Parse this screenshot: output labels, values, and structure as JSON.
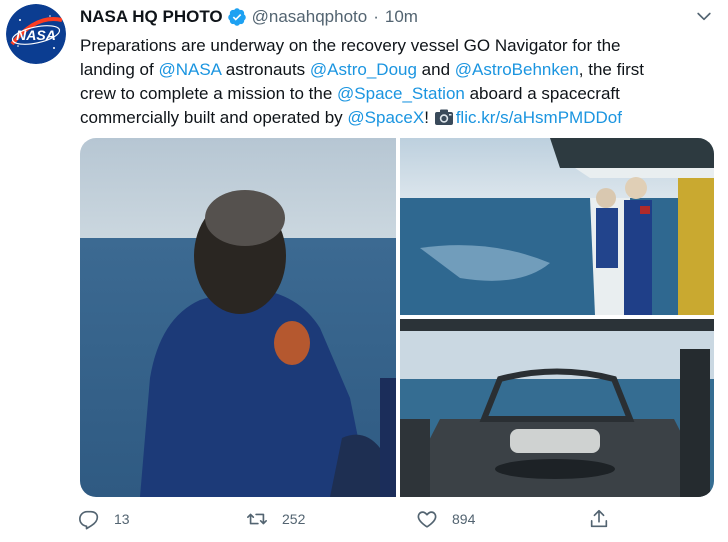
{
  "tweet": {
    "display_name": "NASA HQ PHOTO",
    "handle": "@nasahqphoto",
    "separator": "·",
    "time": "10m",
    "text_runs": [
      "Preparations are underway on the recovery vessel GO Navigator for the",
      "landing of ",
      "@NASA",
      " astronauts ",
      "@Astro_Doug",
      " and ",
      "@AstroBehnken",
      ", the first",
      "crew to complete a mission to the ",
      "@Space_Station",
      " aboard a spacecraft",
      "commercially built and operated by ",
      "@SpaceX",
      "! ",
      "flic.kr/s/aHsmPMDDof"
    ]
  },
  "avatar": {
    "logo_text": "NASA"
  },
  "icons": {
    "verified": "verified-badge-icon",
    "more": "chevron-down-icon",
    "camera": "camera-icon",
    "reply": "reply-icon",
    "retweet": "retweet-icon",
    "like": "heart-icon",
    "share": "share-icon"
  },
  "media": [
    {
      "name": "photo-astronaut-looking-at-sea"
    },
    {
      "name": "photo-astronauts-at-ship-railing"
    },
    {
      "name": "photo-ship-stern-recovery-deck"
    }
  ],
  "actions": {
    "replies": "13",
    "retweets": "252",
    "likes": "894"
  },
  "colors": {
    "link": "#1b95e0",
    "verified": "#1da1f2",
    "muted": "#536471",
    "text": "#0f1419"
  }
}
